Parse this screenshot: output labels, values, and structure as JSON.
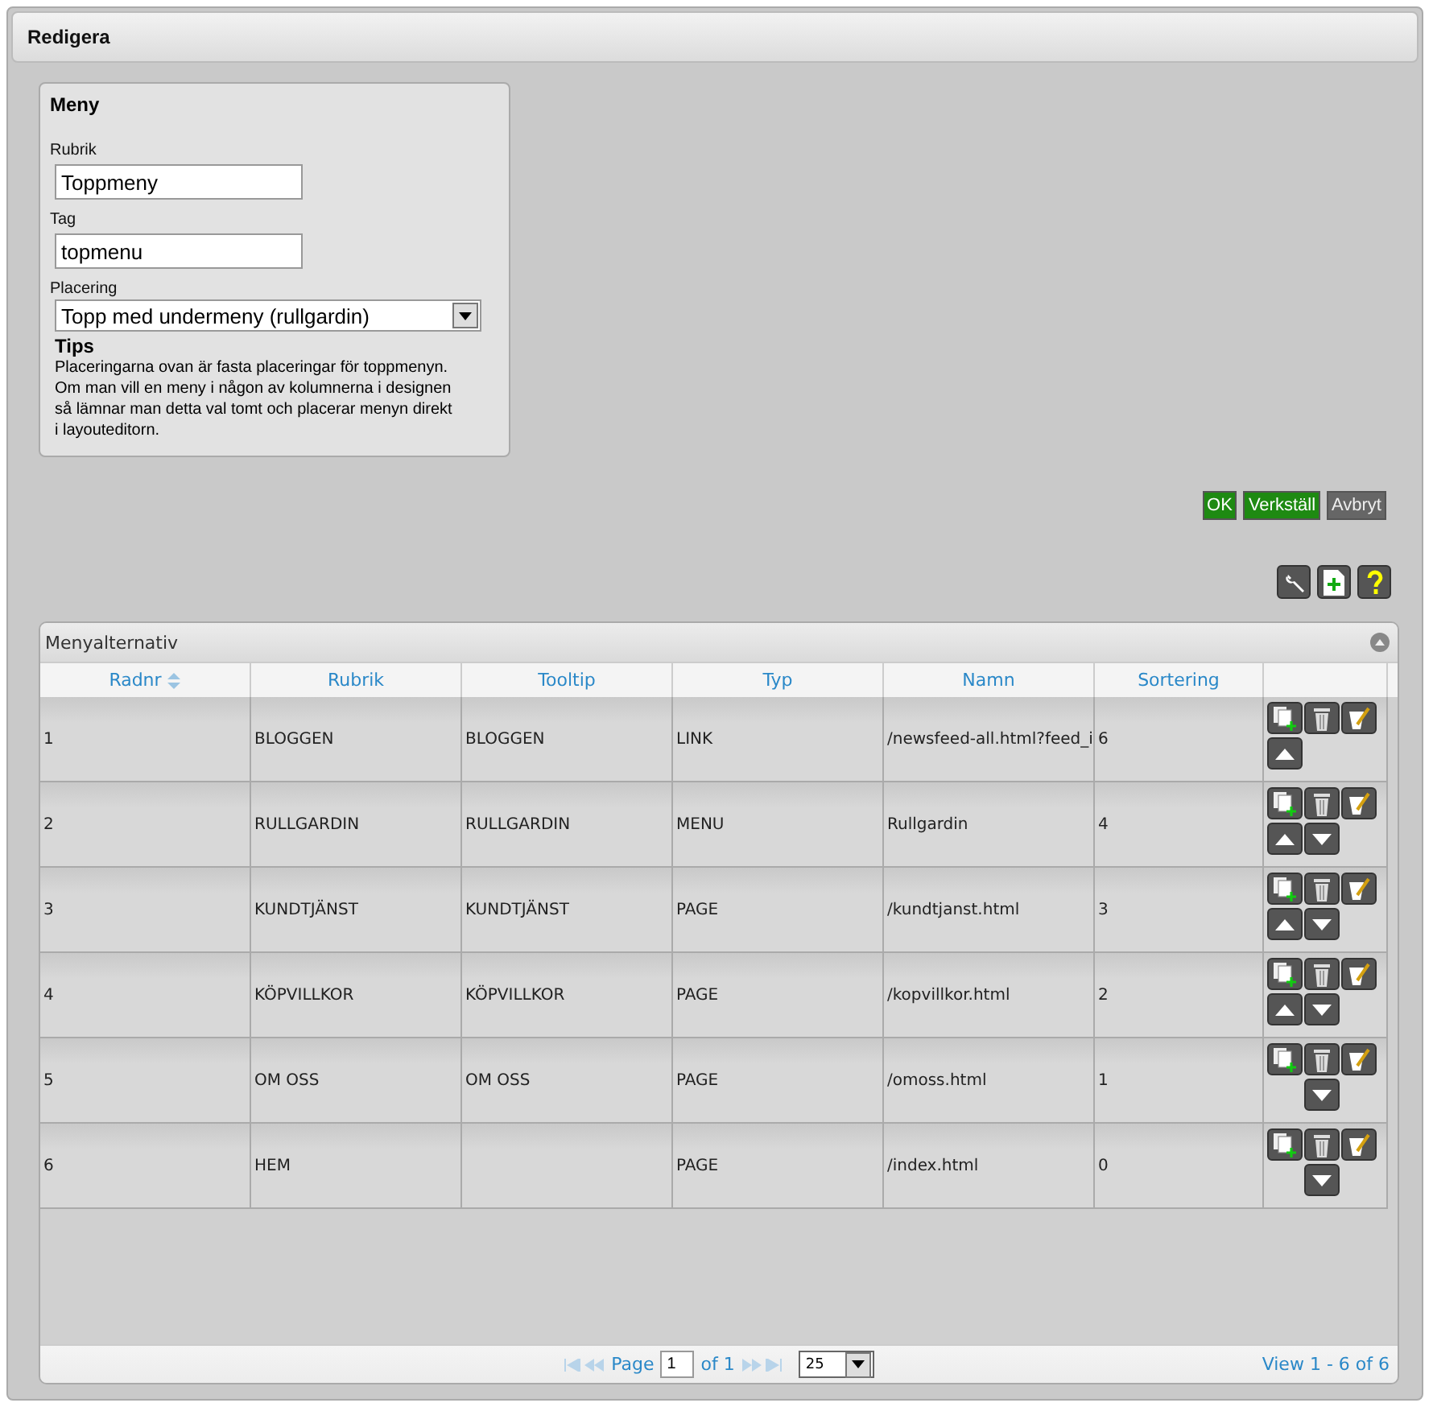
{
  "header": {
    "title": "Redigera"
  },
  "menu_panel": {
    "title": "Meny",
    "fields": [
      {
        "label": "Rubrik",
        "value": "Toppmeny",
        "kind": "text"
      },
      {
        "label": "Tag",
        "value": "topmenu",
        "kind": "text"
      },
      {
        "label": "Placering",
        "value": "Topp med undermeny (rullgardin)",
        "kind": "select"
      }
    ],
    "tips_title": "Tips",
    "tips_text": "Placeringarna ovan är fasta placeringar för toppmenyn. Om man vill en meny i någon av kolumnerna i designen så lämnar man detta val tomt och placerar menyn direkt i layouteditorn."
  },
  "actions": [
    {
      "label": "OK",
      "kind": "primary"
    },
    {
      "label": "Verkställ",
      "kind": "primary"
    },
    {
      "label": "Avbryt",
      "kind": "secondary"
    }
  ],
  "grid": {
    "title": "Menyalternativ",
    "columns": [
      "Radnr",
      "Rubrik",
      "Tooltip",
      "Typ",
      "Namn",
      "Sortering"
    ],
    "rows": [
      {
        "cells": [
          "1",
          "BLOGGEN",
          "BLOGGEN",
          "LINK",
          "/newsfeed-all.html?feed_i",
          "6"
        ],
        "can_move_up": true,
        "can_move_down": false
      },
      {
        "cells": [
          "2",
          "RULLGARDIN",
          "RULLGARDIN",
          "MENU",
          "Rullgardin",
          "4"
        ],
        "can_move_up": true,
        "can_move_down": true
      },
      {
        "cells": [
          "3",
          "KUNDTJÄNST",
          "KUNDTJÄNST",
          "PAGE",
          "/kundtjanst.html",
          "3"
        ],
        "can_move_up": true,
        "can_move_down": true
      },
      {
        "cells": [
          "4",
          "KÖPVILLKOR",
          "KÖPVILLKOR",
          "PAGE",
          "/kopvillkor.html",
          "2"
        ],
        "can_move_up": true,
        "can_move_down": true
      },
      {
        "cells": [
          "5",
          "OM OSS",
          "OM OSS",
          "PAGE",
          "/omoss.html",
          "1"
        ],
        "can_move_up": false,
        "can_move_down": true
      },
      {
        "cells": [
          "6",
          "HEM",
          "",
          "PAGE",
          "/index.html",
          "0"
        ],
        "can_move_up": false,
        "can_move_down": true
      }
    ],
    "pager": {
      "page_label": "Page",
      "page": "1",
      "of_label": "of 1",
      "page_size": "25",
      "summary": "View 1 - 6 of 6"
    }
  }
}
